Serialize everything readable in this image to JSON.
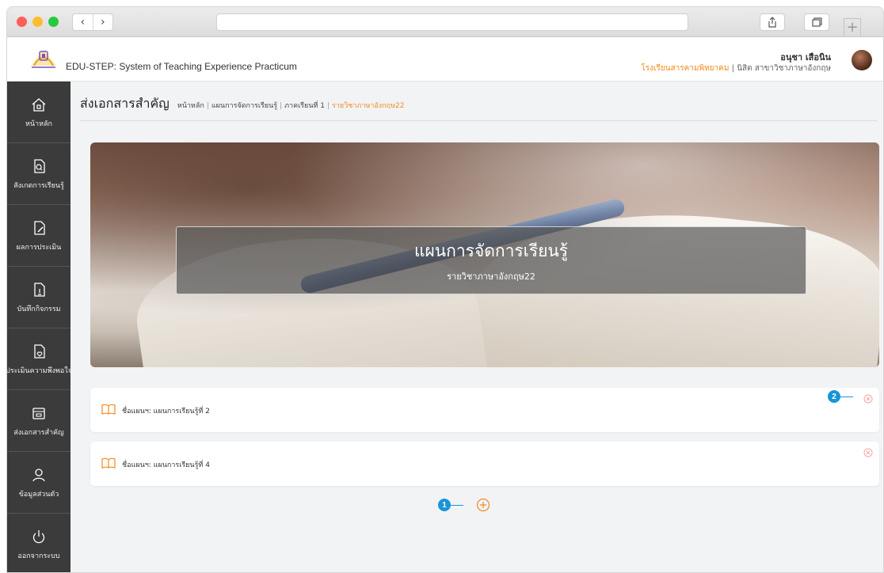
{
  "app": {
    "title": "EDU-STEP: System of Teaching Experience Practicum",
    "user_name": "อนุชา เสือนิน",
    "school": "โรงเรียนสารคามพิทยาคม",
    "divider": "|",
    "student_info": "นิสิต สาขาวิชาภาษาอังกฤษ"
  },
  "sidebar": {
    "items": [
      {
        "label": "หน้าหลัก",
        "icon": "home-icon"
      },
      {
        "label": "สังเกตการเรียนรู้",
        "icon": "document-search-icon"
      },
      {
        "label": "ผลการประเมิน",
        "icon": "document-edit-icon"
      },
      {
        "label": "บันทึกกิจกรรม",
        "icon": "document-person-icon"
      },
      {
        "label": "ประเมินความพึงพอใจ",
        "icon": "document-heart-icon"
      },
      {
        "label": "ส่งเอกสารสำคัญ",
        "icon": "folder-icon"
      },
      {
        "label": "ข้อมูลส่วนตัว",
        "icon": "user-icon"
      },
      {
        "label": "ออกจากระบบ",
        "icon": "power-icon"
      }
    ]
  },
  "page": {
    "title": "ส่งเอกสารสำคัญ",
    "breadcrumb": [
      "หน้าหลัก",
      "แผนการจัดการเรียนรู้",
      "ภาคเรียนที่ 1",
      "รายวิชาภาษาอังกฤษ22"
    ],
    "separator": "|"
  },
  "banner": {
    "title": "แผนการจัดการเรียนรู้",
    "subtitle": "รายวิชาภาษาอังกฤษ22"
  },
  "plans": [
    {
      "label": "ชื่อแผนฯ: แผนการเรียนรู้ที่ 2"
    },
    {
      "label": "ชื่อแผนฯ: แผนการเรียนรู้ที่ 4"
    }
  ],
  "callouts": [
    "1",
    "2"
  ],
  "colors": {
    "accent": "#f08a1c",
    "sidebar": "#3b3b3b",
    "callout": "#1795d6",
    "remove": "#f3a3a3"
  }
}
